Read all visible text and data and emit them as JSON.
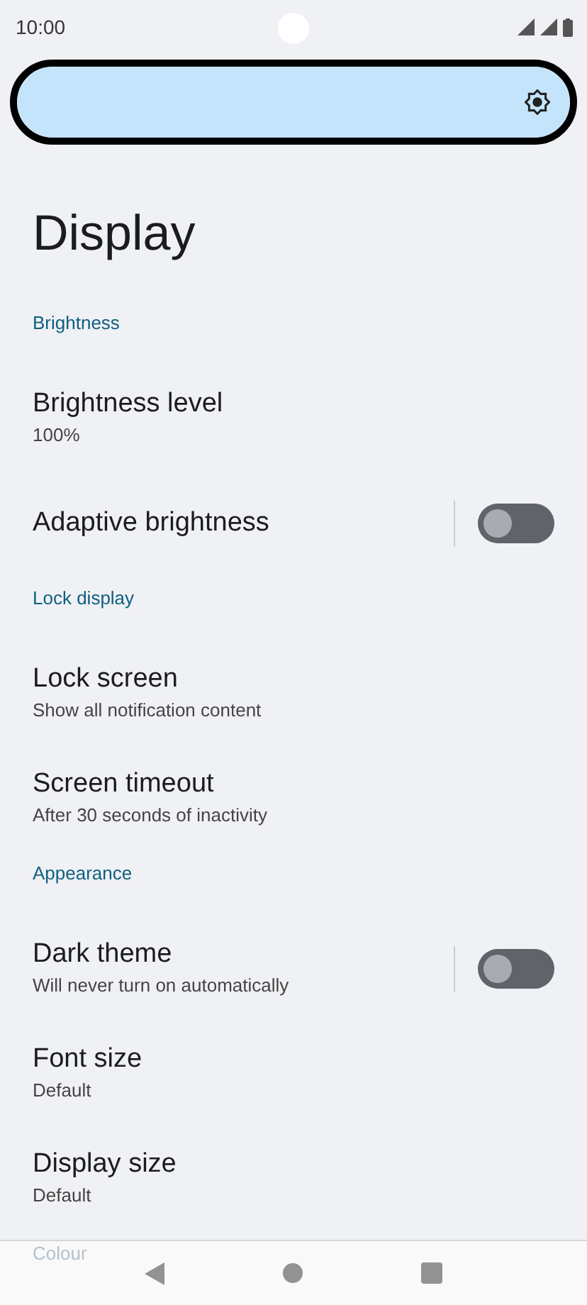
{
  "status_bar": {
    "time": "10:00"
  },
  "brightness_slider": {
    "level": 1,
    "highlighted": true
  },
  "title": "Display",
  "items": [
    {
      "kind": "header",
      "title": "Brightness"
    },
    {
      "kind": "item",
      "title": "Brightness level",
      "summary": "100%"
    },
    {
      "kind": "toggle",
      "title": "Adaptive brightness",
      "on": false
    },
    {
      "kind": "header",
      "title": "Lock display"
    },
    {
      "kind": "item",
      "title": "Lock screen",
      "summary": "Show all notification content"
    },
    {
      "kind": "item",
      "title": "Screen timeout",
      "summary": "After 30 seconds of inactivity"
    },
    {
      "kind": "header",
      "title": "Appearance"
    },
    {
      "kind": "toggle",
      "title": "Dark theme",
      "summary": "Will never turn on automatically",
      "on": false
    },
    {
      "kind": "item",
      "title": "Font size",
      "summary": "Default"
    },
    {
      "kind": "item",
      "title": "Display size",
      "summary": "Default"
    },
    {
      "kind": "header",
      "title": "Colour",
      "faded": true
    }
  ]
}
